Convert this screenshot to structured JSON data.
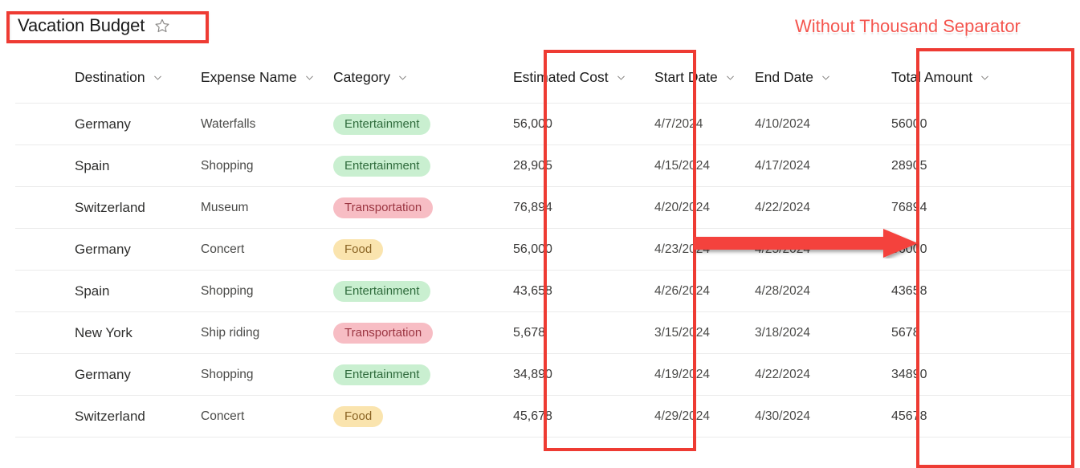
{
  "list": {
    "title": "Vacation Budget",
    "favorite_icon": "star-outline-icon"
  },
  "columns": [
    {
      "key": "destination",
      "label": "Destination",
      "sort_icon": "chevron-down-icon"
    },
    {
      "key": "expense_name",
      "label": "Expense Name",
      "sort_icon": "chevron-down-icon"
    },
    {
      "key": "category",
      "label": "Category",
      "sort_icon": "chevron-down-icon"
    },
    {
      "key": "estimated_cost",
      "label": "Estimated Cost",
      "sort_icon": "chevron-down-icon"
    },
    {
      "key": "start_date",
      "label": "Start Date",
      "sort_icon": "chevron-down-icon"
    },
    {
      "key": "end_date",
      "label": "End Date",
      "sort_icon": "chevron-down-icon"
    },
    {
      "key": "total_amount",
      "label": "Total Amount",
      "sort_icon": "chevron-down-icon"
    }
  ],
  "rows": [
    {
      "destination": "Germany",
      "expense_name": "Waterfalls",
      "category": "Entertainment",
      "category_style": "entertainment",
      "estimated_cost": "56,000",
      "start_date": "4/7/2024",
      "end_date": "4/10/2024",
      "total_amount": "56000"
    },
    {
      "destination": "Spain",
      "expense_name": "Shopping",
      "category": "Entertainment",
      "category_style": "entertainment",
      "estimated_cost": "28,905",
      "start_date": "4/15/2024",
      "end_date": "4/17/2024",
      "total_amount": "28905"
    },
    {
      "destination": "Switzerland",
      "expense_name": "Museum",
      "category": "Transportation",
      "category_style": "transportation",
      "estimated_cost": "76,894",
      "start_date": "4/20/2024",
      "end_date": "4/22/2024",
      "total_amount": "76894"
    },
    {
      "destination": "Germany",
      "expense_name": "Concert",
      "category": "Food",
      "category_style": "food",
      "estimated_cost": "56,000",
      "start_date": "4/23/2024",
      "end_date": "4/25/2024",
      "total_amount": "56000"
    },
    {
      "destination": "Spain",
      "expense_name": "Shopping",
      "category": "Entertainment",
      "category_style": "entertainment",
      "estimated_cost": "43,658",
      "start_date": "4/26/2024",
      "end_date": "4/28/2024",
      "total_amount": "43658"
    },
    {
      "destination": "New York",
      "expense_name": "Ship riding",
      "category": "Transportation",
      "category_style": "transportation",
      "estimated_cost": "5,678",
      "start_date": "3/15/2024",
      "end_date": "3/18/2024",
      "total_amount": "5678"
    },
    {
      "destination": "Germany",
      "expense_name": "Shopping",
      "category": "Entertainment",
      "category_style": "entertainment",
      "estimated_cost": "34,890",
      "start_date": "4/19/2024",
      "end_date": "4/22/2024",
      "total_amount": "34890"
    },
    {
      "destination": "Switzerland",
      "expense_name": "Concert",
      "category": "Food",
      "category_style": "food",
      "estimated_cost": "45,678",
      "start_date": "4/29/2024",
      "end_date": "4/30/2024",
      "total_amount": "45678"
    }
  ],
  "annotations": {
    "caption": "Without Thousand Separator",
    "color": "#ee3b33",
    "caption_color": "#f4554e",
    "arrow_icon": "right-arrow-icon",
    "title_highlight": "Vacation Budget",
    "highlighted_columns": [
      "Estimated Cost",
      "Total Amount"
    ]
  },
  "colors": {
    "entertainment_pill_bg": "#c9efd0",
    "entertainment_pill_text": "#2f6b3c",
    "transportation_pill_bg": "#f7bdc4",
    "transportation_pill_text": "#9b3541",
    "food_pill_bg": "#fae4ae",
    "food_pill_text": "#8a6424",
    "row_separator": "#ebebeb",
    "annotation_red": "#ee3b33"
  }
}
